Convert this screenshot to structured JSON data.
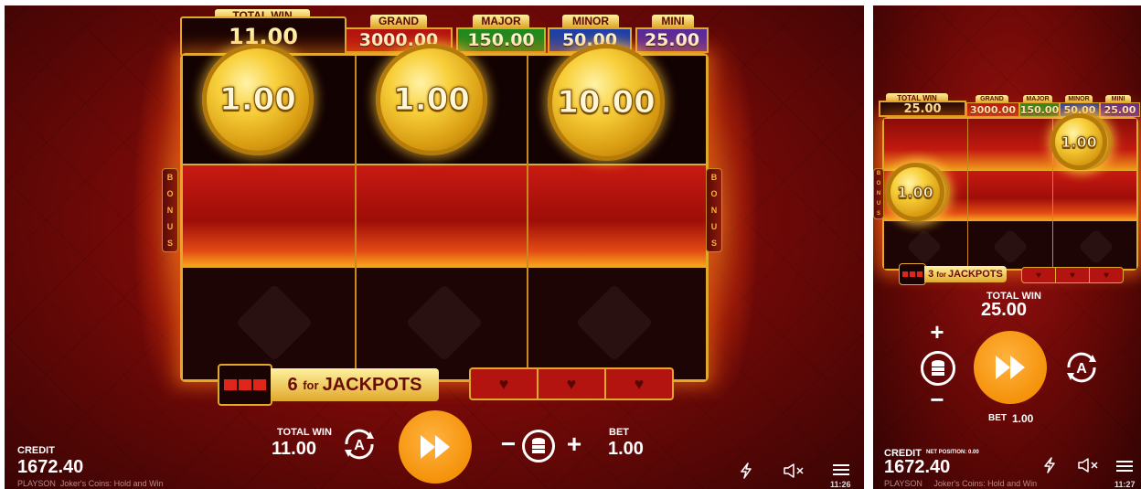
{
  "left": {
    "jackpots": {
      "total_win_label": "TOTAL WIN",
      "total_win_value": "11.00",
      "grand_label": "GRAND",
      "grand_value": "3000.00",
      "major_label": "MAJOR",
      "major_value": "150.00",
      "minor_label": "MINOR",
      "minor_value": "50.00",
      "mini_label": "MINI",
      "mini_value": "25.00"
    },
    "coins": [
      "1.00",
      "1.00",
      "10.00"
    ],
    "bonus_letters": [
      "B",
      "O",
      "N",
      "U",
      "S"
    ],
    "jackpot_bar": {
      "count": "6",
      "for": "for",
      "text": "JACKPOTS"
    },
    "hearts": [
      "♥",
      "♥",
      "♥"
    ],
    "controls": {
      "total_win_label": "TOTAL WIN",
      "total_win_value": "11.00",
      "bet_label": "BET",
      "bet_value": "1.00",
      "minus": "−",
      "plus": "+"
    },
    "credit_label": "CREDIT",
    "credit_value": "1672.40",
    "brand": "PLAYSON",
    "game_title": "Joker's Coins: Hold and Win",
    "clock": "11:26"
  },
  "right": {
    "jackpots": {
      "total_win_label": "TOTAL WIN",
      "total_win_value": "25.00",
      "grand_label": "GRAND",
      "grand_value": "3000.00",
      "major_label": "MAJOR",
      "major_value": "150.00",
      "minor_label": "MINOR",
      "minor_value": "50.00",
      "mini_label": "MINI",
      "mini_value": "25.00"
    },
    "coins": [
      "1.00",
      "1.00"
    ],
    "bonus_letters": [
      "B",
      "O",
      "N",
      "U",
      "S"
    ],
    "jackpot_bar": {
      "count": "3",
      "for": "for",
      "text": "JACKPOTS"
    },
    "hearts": [
      "♥",
      "♥",
      "♥"
    ],
    "controls": {
      "total_win_label": "TOTAL WIN",
      "total_win_value": "25.00",
      "bet_label": "BET",
      "bet_value": "1.00",
      "minus": "−",
      "plus": "+"
    },
    "credit_label": "CREDIT",
    "net_position": "NET POSITION: 0.00",
    "credit_value": "1672.40",
    "brand": "PLAYSON",
    "game_title": "Joker's Coins: Hold and Win",
    "clock": "11:27"
  },
  "colors": {
    "gold": "#e0a92a",
    "grand": "#b3140f",
    "major": "#1f8a1c",
    "minor": "#1c3fa8",
    "mini": "#5a2a9a",
    "spin": "#f5920a"
  },
  "icons": [
    "autoplay-icon",
    "spin-forward-icon",
    "coin-stack-icon",
    "lightning-icon",
    "mute-icon",
    "menu-icon"
  ]
}
